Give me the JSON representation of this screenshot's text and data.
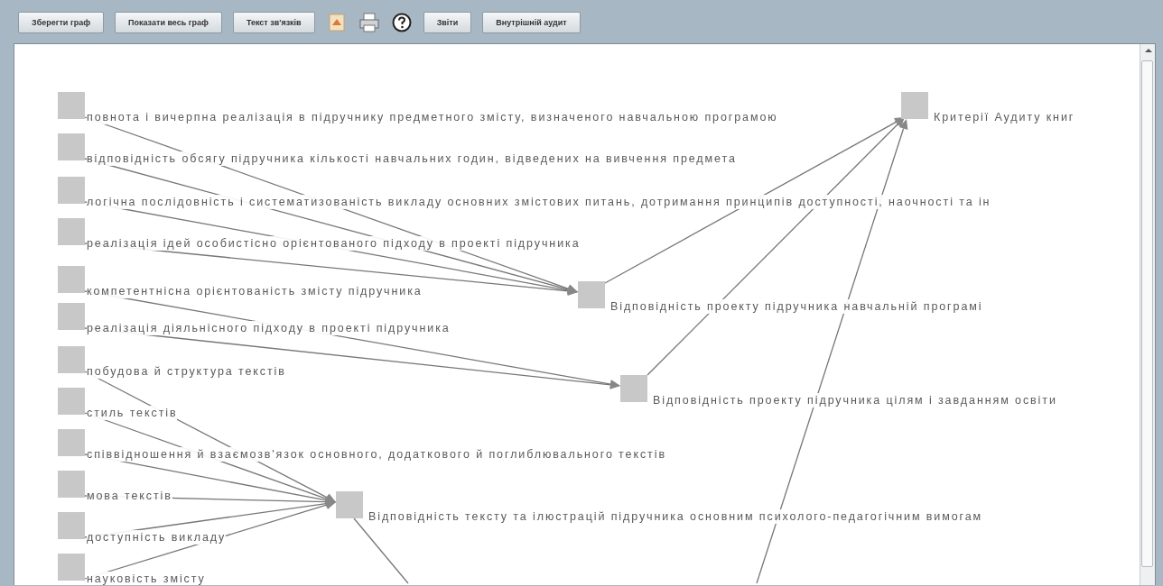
{
  "toolbar": {
    "buttons": [
      {
        "kind": "text",
        "label": "Зберегти граф"
      },
      {
        "kind": "text",
        "label": "Показати весь граф"
      },
      {
        "kind": "text",
        "label": "Текст зв'язків"
      },
      {
        "kind": "export"
      },
      {
        "kind": "print"
      },
      {
        "kind": "help"
      },
      {
        "kind": "text",
        "label": "Звіти"
      },
      {
        "kind": "text",
        "label": "Внутрішній аудит"
      }
    ]
  },
  "graph": {
    "root": {
      "label": "Критерії Аудиту книг"
    },
    "groups": [
      {
        "label": "Відповідність проекту підручника навчальній програмі",
        "items": [
          {
            "label": "повнота і вичерпна реалізація в підручнику предметного змісту, визначеного навчальною програмою"
          },
          {
            "label": "відповідність обсягу підручника кількості навчальних годин, відведених на вивчення предмета"
          },
          {
            "label": "логічна послідовність і систематизованість викладу основних змістових питань, дотримання принципів доступності, наочності та ін"
          },
          {
            "label": "реалізація ідей особистісно орієнтованого підходу в проекті підручника"
          }
        ]
      },
      {
        "label": "Відповідність проекту підручника цілям і завданням освіти",
        "items": [
          {
            "label": "компетентнісна орієнтованість змісту підручника"
          },
          {
            "label": "реалізація діяльнісного підходу в проекті підручника"
          }
        ]
      },
      {
        "label": "Відповідність тексту та ілюстрацій підручника основним психолого-педагогічним вимогам",
        "items": [
          {
            "label": "побудова й структура текстів"
          },
          {
            "label": "стиль текстів"
          },
          {
            "label": "співвідношення й взаємозв'язок основного, додаткового й поглиблювального текстів"
          },
          {
            "label": "мова текстів"
          },
          {
            "label": "доступність викладу"
          },
          {
            "label": "науковість змісту"
          }
        ]
      }
    ]
  }
}
